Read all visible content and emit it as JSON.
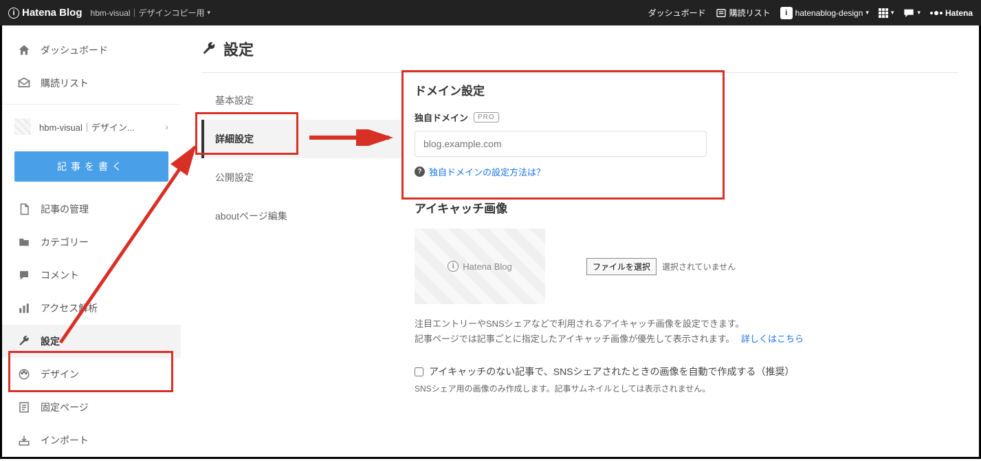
{
  "topbar": {
    "logo": "Hatena Blog",
    "blog": "hbm-visual｜デザインコピー用",
    "dashboard": "ダッシュボード",
    "reading_list": "購読リスト",
    "user": "hatenablog-design",
    "brand": "Hatena"
  },
  "sidebar": {
    "items": [
      {
        "label": "ダッシュボード",
        "icon": "home"
      },
      {
        "label": "購読リスト",
        "icon": "inbox"
      }
    ],
    "blog_label": "hbm-visual｜デザイン...",
    "write_post": "記事を書く",
    "blog_items": [
      {
        "label": "記事の管理",
        "icon": "doc"
      },
      {
        "label": "カテゴリー",
        "icon": "folder"
      },
      {
        "label": "コメント",
        "icon": "comment"
      },
      {
        "label": "アクセス解析",
        "icon": "chart"
      },
      {
        "label": "設定",
        "icon": "wrench",
        "active": true
      },
      {
        "label": "デザイン",
        "icon": "palette"
      },
      {
        "label": "固定ページ",
        "icon": "page"
      },
      {
        "label": "インポート",
        "icon": "import"
      }
    ]
  },
  "content": {
    "title": "設定",
    "tabs": [
      {
        "label": "基本設定"
      },
      {
        "label": "詳細設定",
        "active": true
      },
      {
        "label": "公開設定"
      },
      {
        "label": "aboutページ編集"
      }
    ],
    "domain": {
      "section_title": "ドメイン設定",
      "field_label": "独自ドメイン",
      "pro": "PRO",
      "placeholder": "blog.example.com",
      "help_text": "独自ドメインの設定方法は？"
    },
    "eyecatch": {
      "section_title": "アイキャッチ画像",
      "preview_label": "Hatena Blog",
      "file_button": "ファイルを選択",
      "file_status": "選択されていません",
      "desc1": "注目エントリーやSNSシェアなどで利用されるアイキャッチ画像を設定できます。",
      "desc2": "記事ページでは記事ごとに指定したアイキャッチ画像が優先して表示されます。",
      "more": "詳しくはこちら",
      "checkbox": "アイキャッチのない記事で、SNSシェアされたときの画像を自動で作成する（推奨）",
      "small": "SNSシェア用の画像のみ作成します。記事サムネイルとしては表示されません。"
    }
  }
}
